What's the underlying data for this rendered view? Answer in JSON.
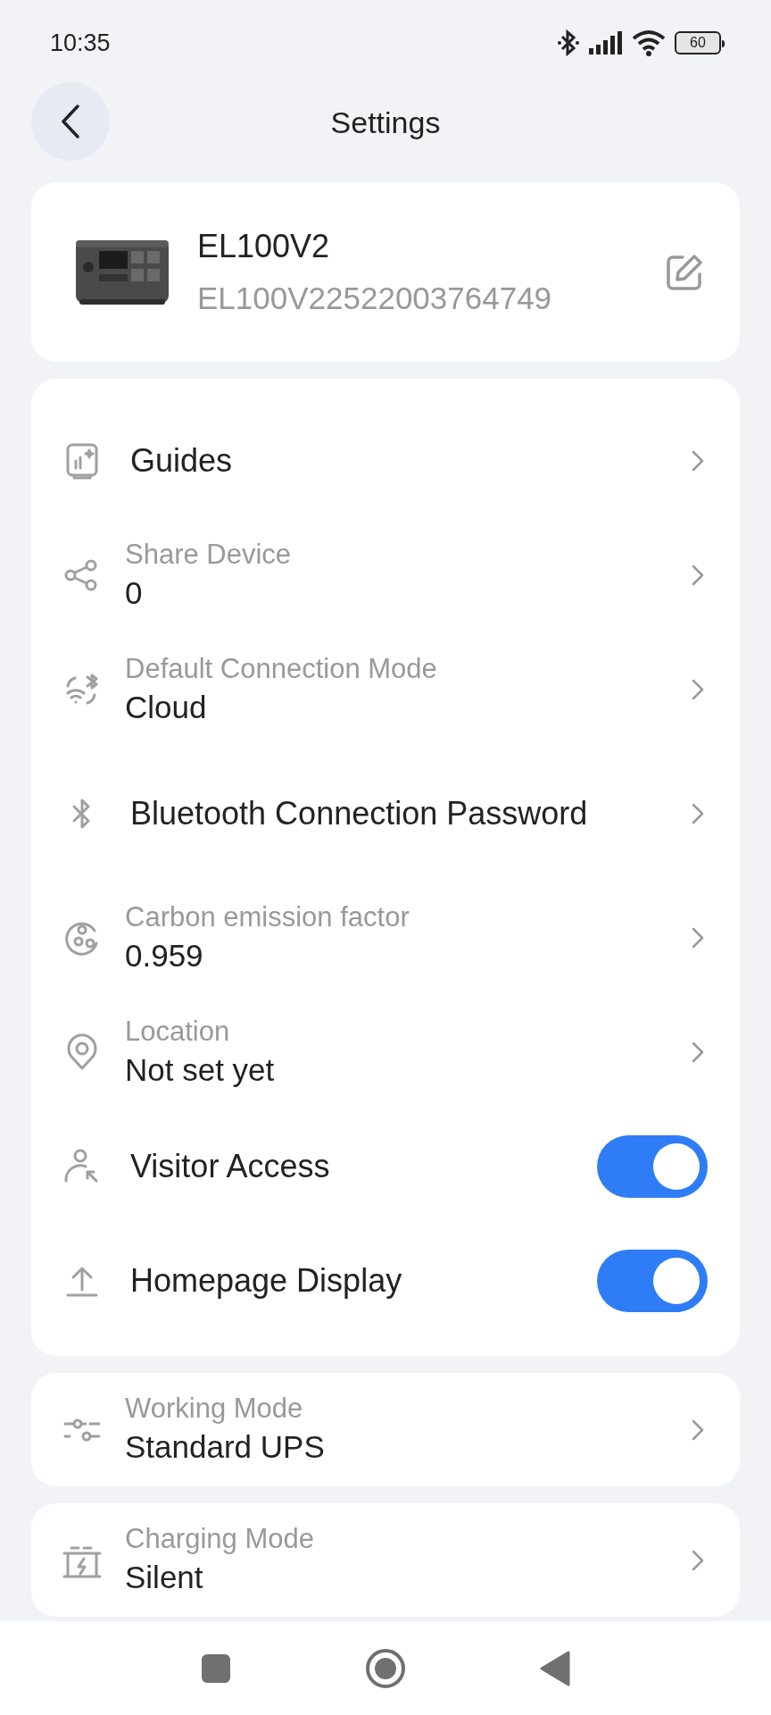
{
  "status_bar": {
    "time": "10:35",
    "battery": "60"
  },
  "header": {
    "title": "Settings"
  },
  "device": {
    "name": "EL100V2",
    "serial": "EL100V22522003764749"
  },
  "sections": [
    {
      "rows": [
        {
          "kind": "link",
          "title": "Guides"
        },
        {
          "kind": "detail",
          "label": "Share Device",
          "value": "0"
        },
        {
          "kind": "detail",
          "label": "Default Connection Mode",
          "value": "Cloud"
        },
        {
          "kind": "link",
          "title": "Bluetooth Connection Password"
        },
        {
          "kind": "detail",
          "label": "Carbon emission factor",
          "value": "0.959"
        },
        {
          "kind": "detail",
          "label": "Location",
          "value": "Not set yet"
        },
        {
          "kind": "toggle",
          "title": "Visitor Access",
          "on": true
        },
        {
          "kind": "toggle",
          "title": "Homepage Display",
          "on": true
        }
      ]
    },
    {
      "rows": [
        {
          "kind": "detail",
          "label": "Working Mode",
          "value": "Standard UPS"
        }
      ]
    },
    {
      "rows": [
        {
          "kind": "detail",
          "label": "Charging Mode",
          "value": "Silent"
        }
      ]
    }
  ]
}
